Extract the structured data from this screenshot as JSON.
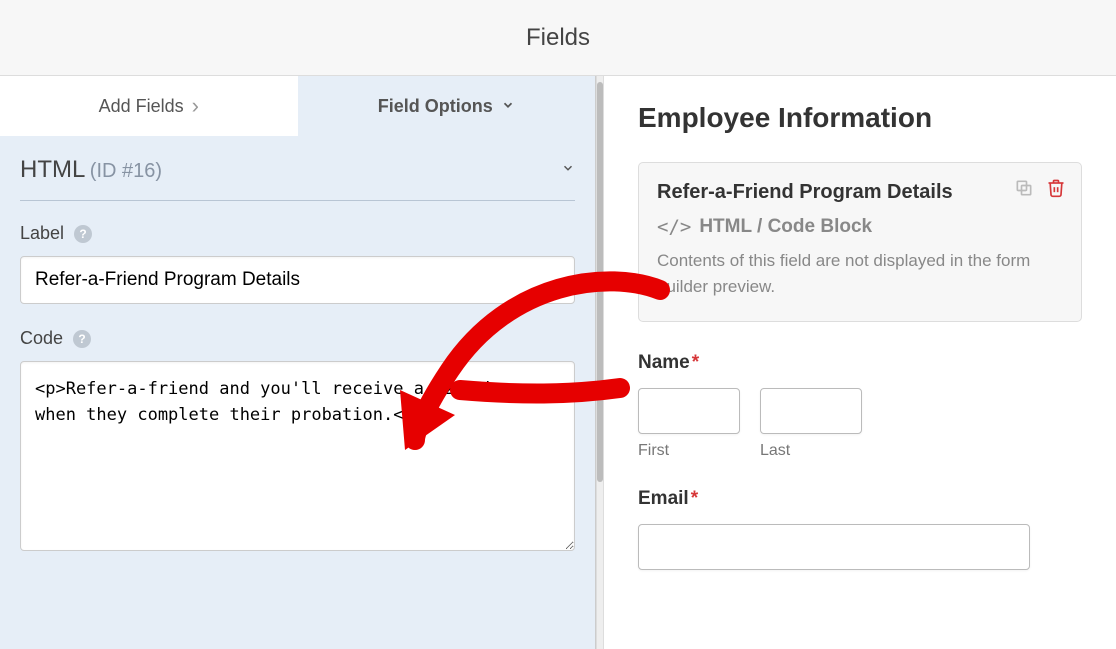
{
  "header": {
    "title": "Fields"
  },
  "tabs": {
    "add_fields": "Add Fields",
    "field_options": "Field Options"
  },
  "section": {
    "title": "HTML",
    "id": "(ID #16)"
  },
  "label_field": {
    "label": "Label",
    "value": "Refer-a-Friend Program Details"
  },
  "code_field": {
    "label": "Code",
    "value": "<p>Refer-a-friend and you'll receive a $200 bonus when they complete their probation.</p>"
  },
  "preview": {
    "title": "Employee Information",
    "block": {
      "title": "Refer-a-Friend Program Details",
      "subtitle": "HTML / Code Block",
      "description": "Contents of this field are not displayed in the form builder preview."
    },
    "name": {
      "label": "Name",
      "first": "First",
      "last": "Last"
    },
    "email": {
      "label": "Email"
    }
  }
}
